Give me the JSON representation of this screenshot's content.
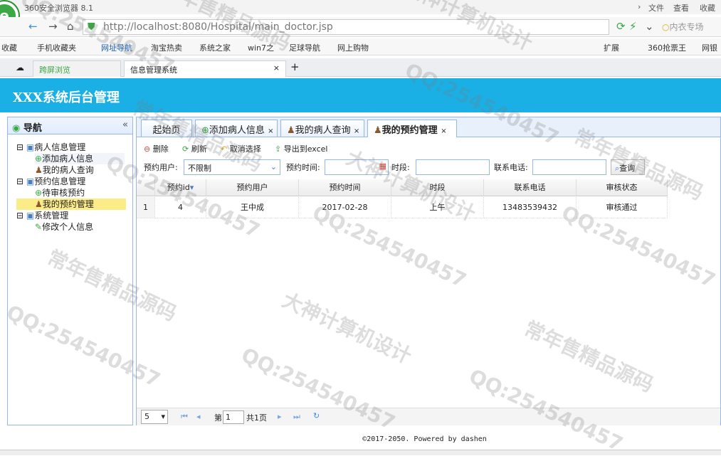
{
  "browser": {
    "title": "360安全浏览器 8.1",
    "menu": [
      "文件",
      "查看",
      "收藏"
    ],
    "url": "http://localhost:8080/Hospital/main_doctor.jsp",
    "search_placeholder": "内衣专场",
    "bookmarks": [
      "收藏",
      "手机收藏夹",
      "网址导航",
      "淘宝热卖",
      "系统之家",
      "win7之",
      "足球导航",
      "网上购物"
    ],
    "right_bookmarks": [
      "扩展",
      "360抢票王",
      "网银"
    ],
    "tabs": [
      "跨屏浏览",
      "信息管理系统"
    ]
  },
  "app": {
    "header_title": "XXX系统后台管理",
    "nav_title": "导航",
    "tree": [
      {
        "label": "病人信息管理",
        "level": 0
      },
      {
        "label": "添加病人信息",
        "level": 1
      },
      {
        "label": "我的病人查询",
        "level": 1
      },
      {
        "label": "预约信息管理",
        "level": 0
      },
      {
        "label": "待审核预约",
        "level": 1
      },
      {
        "label": "我的预约管理",
        "level": 1,
        "selected": true
      },
      {
        "label": "系统管理",
        "level": 0
      },
      {
        "label": "修改个人信息",
        "level": 1
      }
    ],
    "content_tabs": [
      "起始页",
      "添加病人信息",
      "我的病人查询",
      "我的预约管理"
    ],
    "toolbar": {
      "delete": "删除",
      "refresh": "刷新",
      "cancel": "取消选择",
      "export": "导出到excel"
    },
    "filter": {
      "user_label": "预约用户:",
      "user_value": "不限制",
      "time_label": "预约时间:",
      "period_label": "时段:",
      "phone_label": "联系电话:",
      "search_button": "查询"
    },
    "grid": {
      "columns": [
        "预约id",
        "预约用户",
        "预约时间",
        "时段",
        "联系电话",
        "审核状态"
      ],
      "rows": [
        {
          "num": "1",
          "id": "4",
          "user": "王中成",
          "time": "2017-02-28",
          "period": "上午",
          "phone": "13483539432",
          "status": "审核通过"
        }
      ]
    },
    "pager": {
      "size": "5",
      "page_prefix": "第",
      "page": "1",
      "total": "共1页"
    },
    "footer": "©2017-2050. Powered by dashen"
  },
  "watermarks": [
    "QQ:254540457",
    "常年售精品源码",
    "大神计算机设计"
  ],
  "colors": {
    "header": "#1ab0e6",
    "border": "#95b8e7",
    "selected": "#fbec88"
  }
}
